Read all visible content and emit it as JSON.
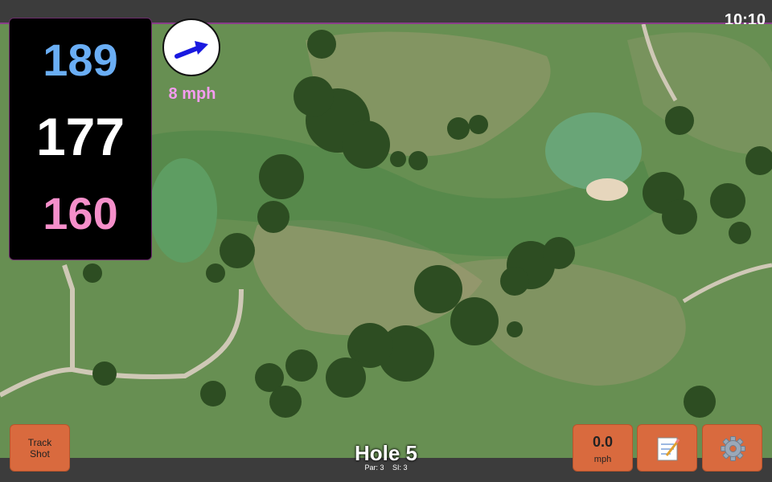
{
  "status_bar": {
    "time": "10:10"
  },
  "distances": {
    "back": "189",
    "middle": "177",
    "front": "160"
  },
  "wind": {
    "speed_text": "8 mph"
  },
  "buttons": {
    "track_shot": "Track Shot",
    "speed_value": "0.0",
    "speed_unit": "mph"
  },
  "hole": {
    "title": "Hole 5",
    "par": "Par: 3",
    "si": "SI: 3"
  },
  "icons": {
    "wind": "arrow-icon",
    "notes": "notepad-icon",
    "settings": "gear-icon"
  },
  "colors": {
    "back": "#6aaef5",
    "middle": "#ffffff",
    "front": "#f58fca",
    "wind_text": "#f59cf0",
    "button": "#d96a3e"
  }
}
